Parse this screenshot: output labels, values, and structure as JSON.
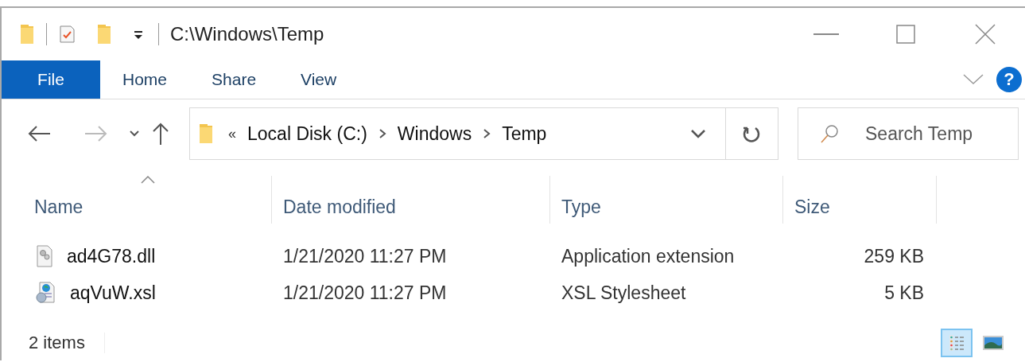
{
  "window": {
    "title": "C:\\Windows\\Temp"
  },
  "ribbon": {
    "tabs": [
      {
        "label": "File",
        "selected": true
      },
      {
        "label": "Home",
        "selected": false
      },
      {
        "label": "Share",
        "selected": false
      },
      {
        "label": "View",
        "selected": false
      }
    ],
    "help": "?"
  },
  "address_bar": {
    "overflow": "«",
    "breadcrumbs": [
      "Local Disk (C:)",
      "Windows",
      "Temp"
    ]
  },
  "search": {
    "placeholder": "Search Temp"
  },
  "table": {
    "columns": [
      {
        "label": "Name",
        "sorted": true
      },
      {
        "label": "Date modified",
        "sorted": false
      },
      {
        "label": "Type",
        "sorted": false
      },
      {
        "label": "Size",
        "sorted": false
      }
    ],
    "rows": [
      {
        "kind": "dll",
        "name": "ad4G78.dll",
        "date_modified": "1/21/2020 11:27 PM",
        "type": "Application extension",
        "size": "259 KB"
      },
      {
        "kind": "xsl",
        "name": "aqVuW.xsl",
        "date_modified": "1/21/2020 11:27 PM",
        "type": "XSL Stylesheet",
        "size": "5 KB"
      }
    ]
  },
  "status_bar": {
    "item_count": "2 items",
    "views": [
      {
        "kind": "details",
        "selected": true
      },
      {
        "kind": "large-icons",
        "selected": false
      }
    ]
  }
}
